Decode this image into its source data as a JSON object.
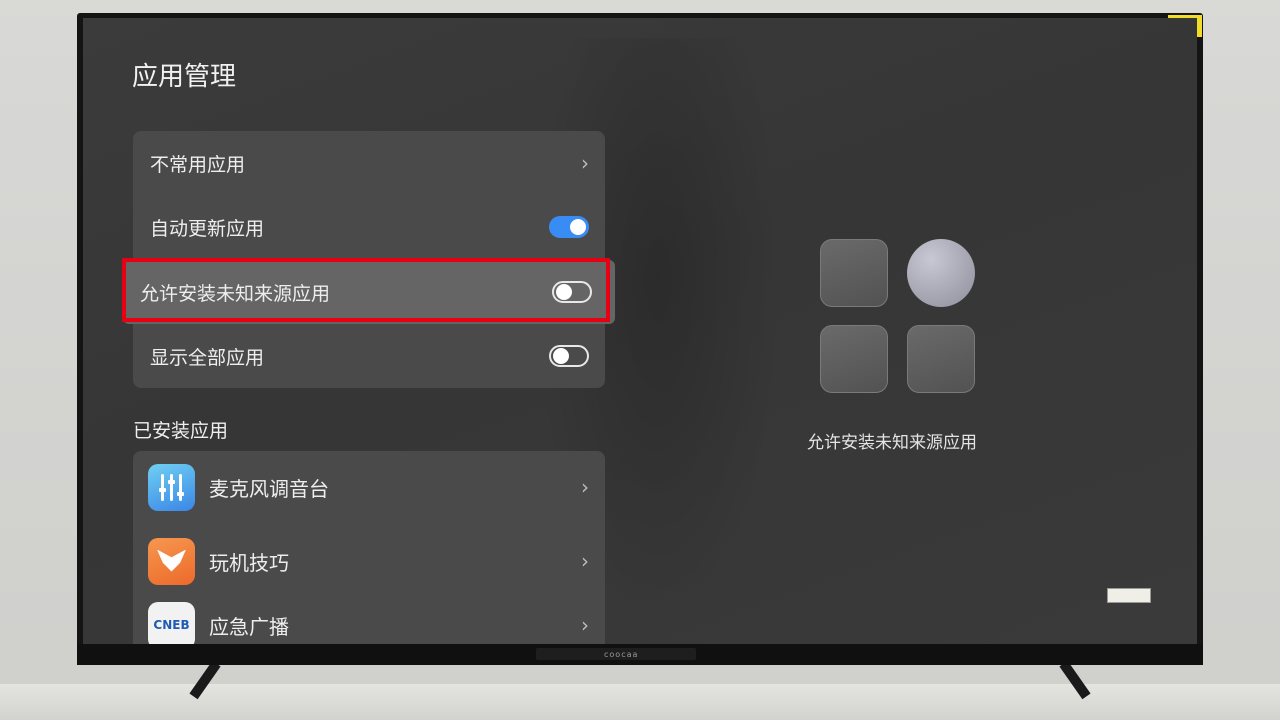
{
  "page": {
    "title": "应用管理"
  },
  "settings": {
    "rows": [
      {
        "label": "不常用应用",
        "control": "chevron"
      },
      {
        "label": "自动更新应用",
        "control": "toggle",
        "on": true
      },
      {
        "label": "允许安装未知来源应用",
        "control": "toggle",
        "on": false,
        "focused": true
      },
      {
        "label": "显示全部应用",
        "control": "toggle",
        "on": false
      }
    ]
  },
  "installed": {
    "title": "已安装应用",
    "apps": [
      {
        "name": "麦克风调音台",
        "icon": "mixer-icon"
      },
      {
        "name": "玩机技巧",
        "icon": "tips-icon"
      },
      {
        "name": "应急广播",
        "icon": "cneb-icon",
        "icon_text": "CNEB"
      }
    ]
  },
  "preview": {
    "caption": "允许安装未知来源应用"
  },
  "tv": {
    "brand": "coocaa"
  },
  "colors": {
    "highlight": "#e60012",
    "toggle_on": "#3a8cf5"
  }
}
